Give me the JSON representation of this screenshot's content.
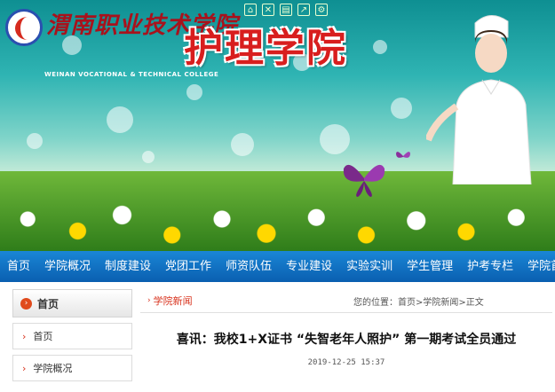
{
  "header": {
    "toolbar_icons": [
      "home-icon",
      "shuffle-icon",
      "page-icon",
      "export-icon",
      "settings-icon"
    ],
    "school_name_cn": "渭南职业技术学院",
    "school_name_en": "WEINAN VOCATIONAL & TECHNICAL COLLEGE",
    "college_name": "护理学院"
  },
  "nav": {
    "items": [
      {
        "label": "首页"
      },
      {
        "label": "学院概况"
      },
      {
        "label": "制度建设"
      },
      {
        "label": "党团工作"
      },
      {
        "label": "师资队伍"
      },
      {
        "label": "专业建设"
      },
      {
        "label": "实验实训"
      },
      {
        "label": "学生管理"
      },
      {
        "label": "护考专栏"
      },
      {
        "label": "学院首页"
      }
    ]
  },
  "sidebar": {
    "heading": "首页",
    "items": [
      {
        "label": "首页"
      },
      {
        "label": "学院概况"
      }
    ]
  },
  "main": {
    "section_title": "学院新闻",
    "location": "您的位置：首页>学院新闻>正文",
    "article_title": "喜讯：我校1+X证书 “失智老年人照护” 第一期考试全员通过",
    "article_date": "2019-12-25 15:37"
  },
  "colors": {
    "nav_bg": "#0a5fb0",
    "accent_red": "#d8331e",
    "college_title_red": "#d81e1e"
  }
}
